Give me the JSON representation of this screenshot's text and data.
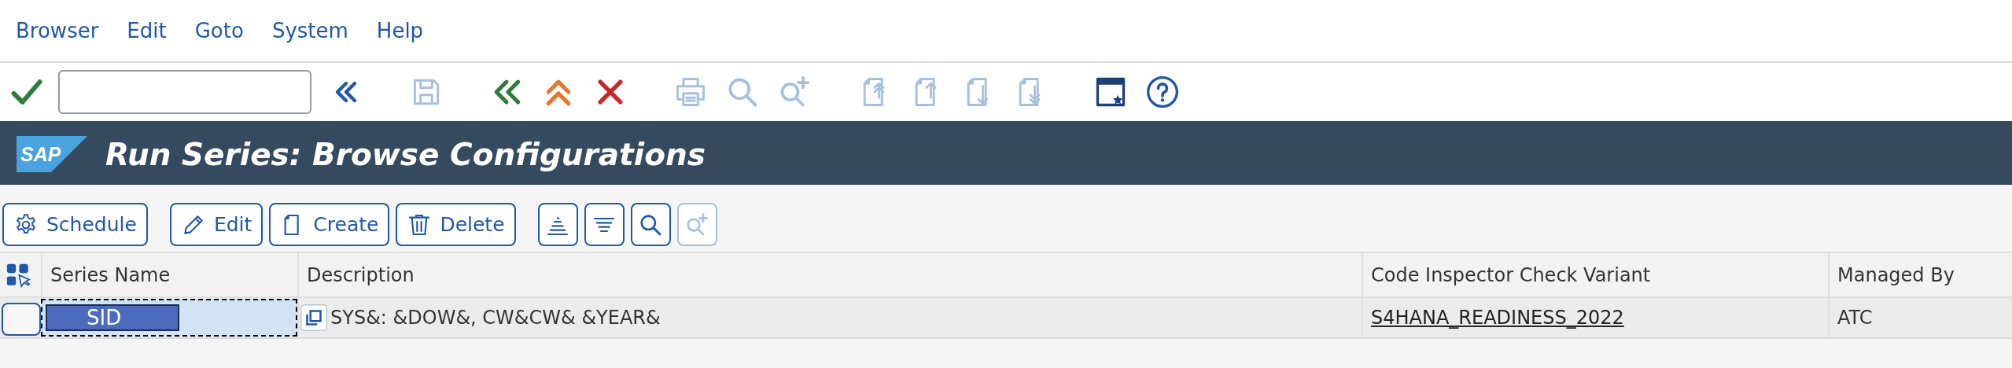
{
  "menu_bar": [
    {
      "label": "Browser"
    },
    {
      "label": "Edit"
    },
    {
      "label": "Goto"
    },
    {
      "label": "System"
    },
    {
      "label": "Help"
    }
  ],
  "toolbar": {
    "items": [
      {
        "kind": "enter",
        "disabled": false
      },
      {
        "kind": "command_field"
      },
      {
        "kind": "collapse",
        "disabled": false
      },
      {
        "kind": "save",
        "disabled": true
      },
      {
        "kind": "back",
        "disabled": false
      },
      {
        "kind": "exit",
        "disabled": false
      },
      {
        "kind": "cancel",
        "disabled": false
      },
      {
        "kind": "print",
        "disabled": true
      },
      {
        "kind": "find",
        "disabled": true
      },
      {
        "kind": "find_next",
        "disabled": true
      },
      {
        "kind": "first_page",
        "disabled": true
      },
      {
        "kind": "previous_page",
        "disabled": true
      },
      {
        "kind": "next_page",
        "disabled": true
      },
      {
        "kind": "last_page",
        "disabled": true
      },
      {
        "kind": "layout",
        "disabled": false
      },
      {
        "kind": "help",
        "disabled": false
      }
    ]
  },
  "title_bar": {
    "logo": "SAP",
    "title": "Run Series: Browse Configurations"
  },
  "app_toolbar": [
    {
      "kind": "schedule",
      "label": "Schedule",
      "disabled": false
    },
    {
      "kind": "edit",
      "label": "Edit",
      "disabled": false
    },
    {
      "kind": "create",
      "label": "Create",
      "disabled": false
    },
    {
      "kind": "delete",
      "label": "Delete",
      "disabled": false
    },
    {
      "kind": "sort_ascending",
      "disabled": false
    },
    {
      "kind": "filter",
      "disabled": false
    },
    {
      "kind": "find",
      "disabled": false
    },
    {
      "kind": "find_next",
      "disabled": true
    }
  ],
  "table": {
    "columns": [
      "Series Name",
      "Description",
      "Code Inspector Check Variant",
      "Managed By"
    ],
    "rows": [
      {
        "selected": false,
        "series_name": {
          "value": "SID",
          "focused": true,
          "text_selected": true
        },
        "description": "SYS&: &DOW&, CW&CW& &YEAR&",
        "check_variant": "S4HANA_READINESS_2022",
        "managed_by": "ATC"
      }
    ]
  }
}
